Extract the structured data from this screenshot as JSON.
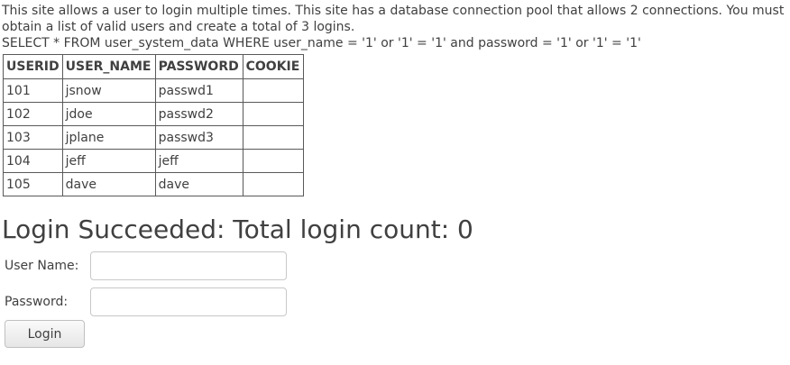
{
  "intro_text": "This site allows a user to login multiple times. This site has a database connection pool that allows 2 connections. You must obtain a list of valid users and create a total of 3 logins.",
  "sql_query": "SELECT * FROM user_system_data WHERE user_name = '1' or '1' = '1' and password = '1' or '1' = '1'",
  "table": {
    "headers": [
      "USERID",
      "USER_NAME",
      "PASSWORD",
      "COOKIE"
    ],
    "rows": [
      [
        "101",
        "jsnow",
        "passwd1",
        ""
      ],
      [
        "102",
        "jdoe",
        "passwd2",
        ""
      ],
      [
        "103",
        "jplane",
        "passwd3",
        ""
      ],
      [
        "104",
        "jeff",
        "jeff",
        ""
      ],
      [
        "105",
        "dave",
        "dave",
        ""
      ]
    ]
  },
  "status_message": "Login Succeeded: Total login count: 0",
  "form": {
    "username_label": "User Name:",
    "username_value": "",
    "password_label": "Password:",
    "password_value": "",
    "login_button": "Login"
  }
}
